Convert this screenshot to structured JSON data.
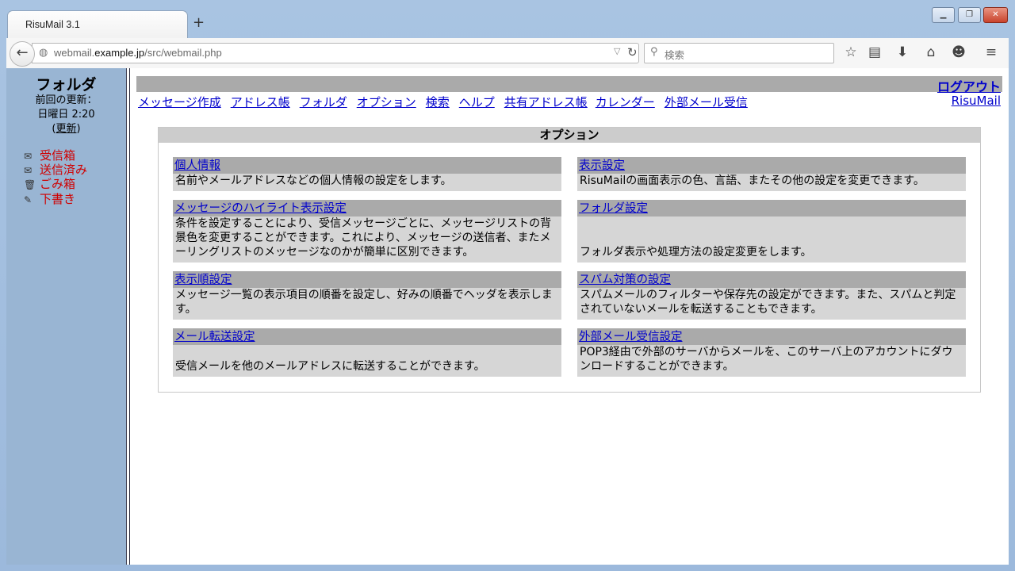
{
  "browser": {
    "tab_title": "RisuMail 3.1",
    "new_tab": "+",
    "url_prefix": "webmail.",
    "url_domain": "example.jp",
    "url_path": "/src/webmail.php",
    "search_placeholder": "検索"
  },
  "left": {
    "title": "フォルダ",
    "last_update_label": "前回の更新：",
    "last_update_time": "日曜日 2:20",
    "refresh_open": "(",
    "refresh": "更新",
    "refresh_close": ")",
    "folders": [
      {
        "label": "受信箱",
        "icon": "inbox-icon"
      },
      {
        "label": "送信済み",
        "icon": "sent-icon"
      },
      {
        "label": "ごみ箱",
        "icon": "trash-icon"
      },
      {
        "label": "下書き",
        "icon": "drafts-icon"
      }
    ]
  },
  "header": {
    "logout": "ログアウト",
    "brand": "RisuMail",
    "menu": [
      "メッセージ作成",
      "アドレス帳",
      "フォルダ",
      "オプション",
      "検索",
      "ヘルプ",
      "共有アドレス帳",
      "カレンダー",
      "外部メール受信"
    ]
  },
  "options": {
    "title": "オプション",
    "items": [
      {
        "title": "個人情報",
        "desc": "名前やメールアドレスなどの個人情報の設定をします。"
      },
      {
        "title": "表示設定",
        "desc": "RisuMailの画面表示の色、言語、またその他の設定を変更できます。"
      },
      {
        "title": "メッセージのハイライト表示設定",
        "desc": "条件を設定することにより、受信メッセージごとに、メッセージリストの背景色を変更することができます。これにより、メッセージの送信者、またメーリングリストのメッセージなのかが簡単に区別できます。"
      },
      {
        "title": "フォルダ設定",
        "desc": "フォルダ表示や処理方法の設定変更をします。"
      },
      {
        "title": "表示順設定",
        "desc": "メッセージ一覧の表示項目の順番を設定し、好みの順番でヘッダを表示します。"
      },
      {
        "title": "スパム対策の設定",
        "desc": "スパムメールのフィルターや保存先の設定ができます。また、スパムと判定されていないメールを転送することもできます。"
      },
      {
        "title": "メール転送設定",
        "desc": "受信メールを他のメールアドレスに転送することができます。"
      },
      {
        "title": "外部メール受信設定",
        "desc": "POP3経由で外部のサーバからメールを、このサーバ上のアカウントにダウンロードすることができます。"
      }
    ]
  }
}
